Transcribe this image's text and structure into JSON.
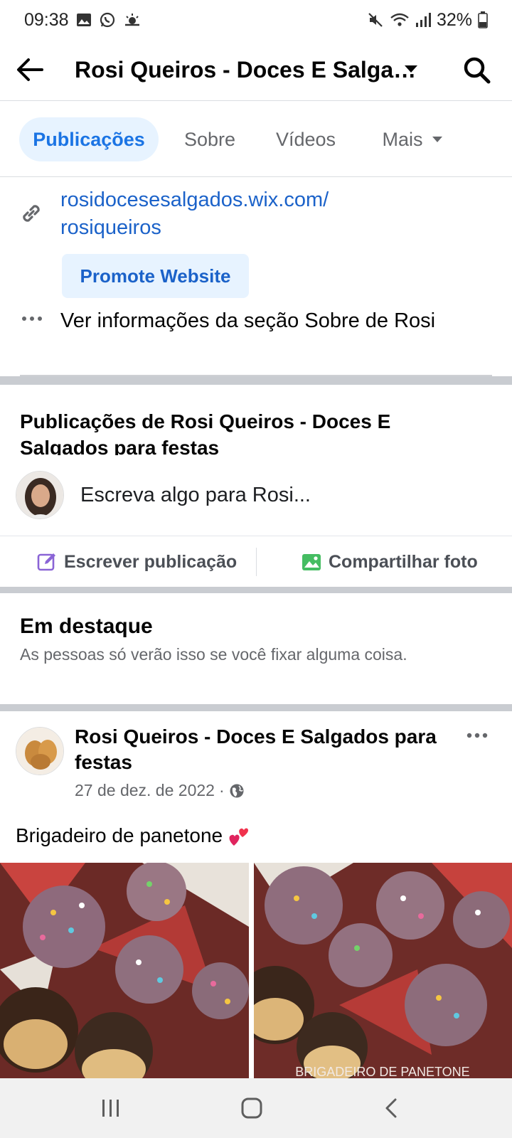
{
  "status_bar": {
    "time": "09:38",
    "battery": "32%",
    "icons": [
      "gallery-icon",
      "whatsapp-icon",
      "weather-icon",
      "mute-icon",
      "wifi-icon",
      "signal-icon",
      "battery-icon"
    ]
  },
  "header": {
    "title": "Rosi Queiros - Doces E Salga…",
    "back_icon": "arrow-left-icon",
    "search_icon": "search-icon"
  },
  "tabs": [
    {
      "label": "Publicações",
      "active": true
    },
    {
      "label": "Sobre",
      "active": false
    },
    {
      "label": "Vídeos",
      "active": false
    },
    {
      "label": "Mais",
      "active": false
    }
  ],
  "info": {
    "website_line1": "rosidocesesalgados.wix.com/",
    "website_line2": "rosiqueiros",
    "promote_label": "Promote Website",
    "about_link": "Ver informações da seção Sobre de Rosi"
  },
  "composer": {
    "heading": "Publicações de Rosi Queiros - Doces E Salgados para festas",
    "placeholder": "Escreva algo para Rosi...",
    "write_label": "Escrever publicação",
    "share_photo_label": "Compartilhar foto"
  },
  "featured": {
    "title": "Em destaque",
    "subtitle": "As pessoas só verão isso se você fixar alguma coisa."
  },
  "post": {
    "author": "Rosi Queiros - Doces E Salgados para festas",
    "date": "27 de dez. de 2022",
    "separator": "·",
    "text": "Brigadeiro de panetone",
    "photo_caption": "BRIGADEIRO DE PANETONE"
  },
  "colors": {
    "accent": "#1b74e4",
    "link": "#1b62c9",
    "tab_active_bg": "#e7f3ff",
    "separator": "#c9ccd1"
  }
}
